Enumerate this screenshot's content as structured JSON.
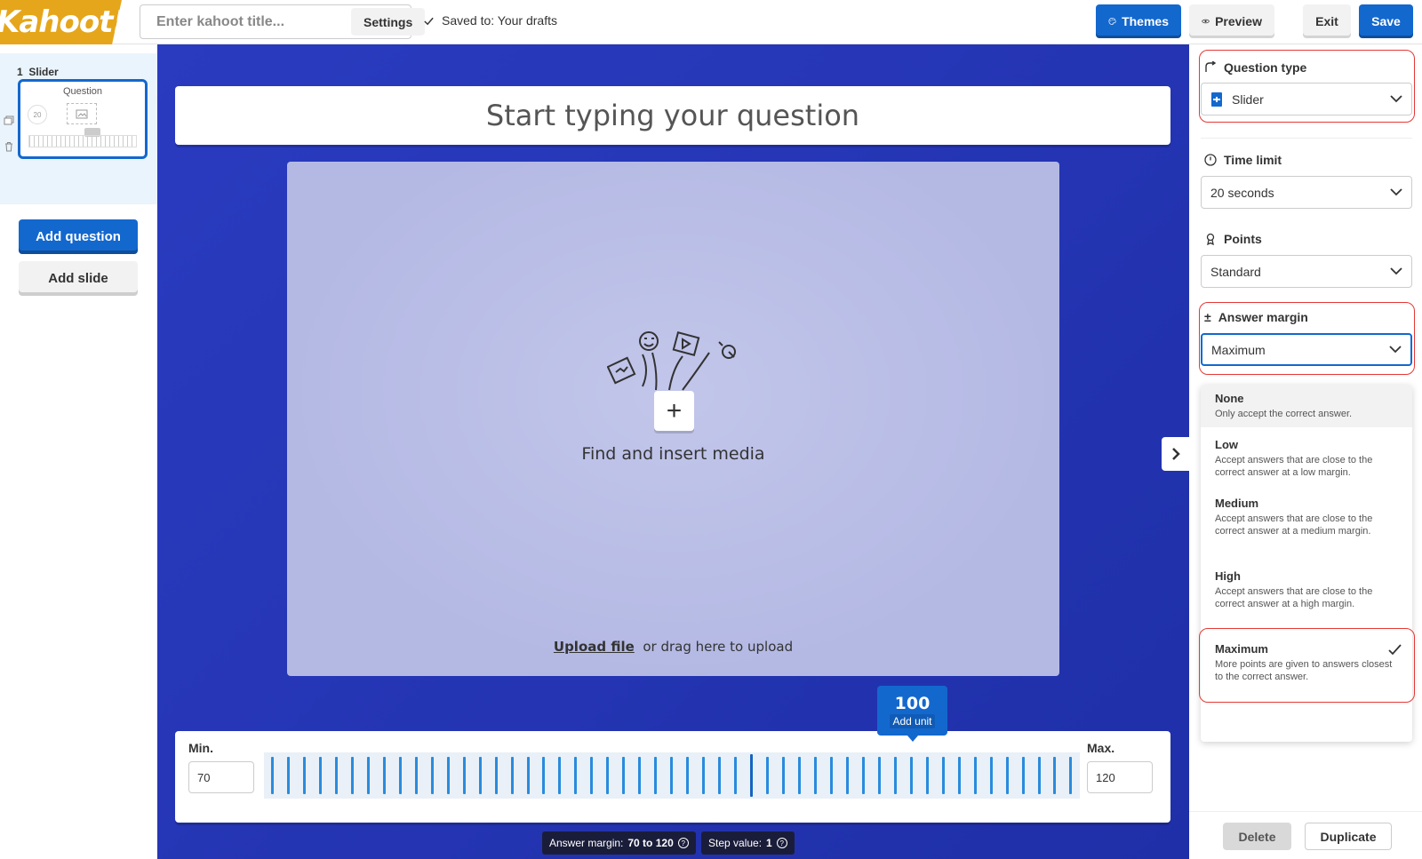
{
  "brand": {
    "logo_text": "Kahoot!"
  },
  "header": {
    "title_placeholder": "Enter kahoot title...",
    "settings_label": "Settings",
    "saved_status": "Saved to: Your drafts",
    "themes_label": "Themes",
    "preview_label": "Preview",
    "exit_label": "Exit",
    "save_label": "Save"
  },
  "sidebar": {
    "slides": [
      {
        "number": "1",
        "type": "Slider",
        "thumb_title": "Question",
        "thumb_timer": "20"
      }
    ],
    "add_question_label": "Add question",
    "add_slide_label": "Add slide"
  },
  "editor": {
    "question_placeholder": "Start typing your question",
    "media": {
      "find_label": "Find and insert media",
      "upload_link": "Upload file",
      "upload_suffix": "or drag here to upload"
    },
    "slider": {
      "min_label": "Min.",
      "max_label": "Max.",
      "min_value": "70",
      "max_value": "120",
      "current_value": "100",
      "unit_label": "Add unit",
      "answer_margin_label": "Answer margin:",
      "answer_margin_value": "70 to 120",
      "step_label": "Step value:",
      "step_value": "1"
    }
  },
  "right_panel": {
    "question_type": {
      "label": "Question type",
      "value": "Slider"
    },
    "time_limit": {
      "label": "Time limit",
      "value": "20 seconds"
    },
    "points": {
      "label": "Points",
      "value": "Standard"
    },
    "answer_margin": {
      "label": "Answer margin",
      "value": "Maximum",
      "options": [
        {
          "title": "None",
          "desc": "Only accept the correct answer."
        },
        {
          "title": "Low",
          "desc": "Accept answers that are close to the correct answer at a low margin."
        },
        {
          "title": "Medium",
          "desc": "Accept answers that are close to the correct answer at a medium margin."
        },
        {
          "title": "High",
          "desc": "Accept answers that are close to the correct answer at a high margin."
        },
        {
          "title": "Maximum",
          "desc": "More points are given to answers closest to the correct answer."
        }
      ]
    },
    "delete_label": "Delete",
    "duplicate_label": "Duplicate"
  },
  "colors": {
    "brand_blue": "#1368ce",
    "canvas_blue": "#2434b8",
    "logo_gold": "#e6a61b",
    "highlight_red": "#e53935"
  }
}
